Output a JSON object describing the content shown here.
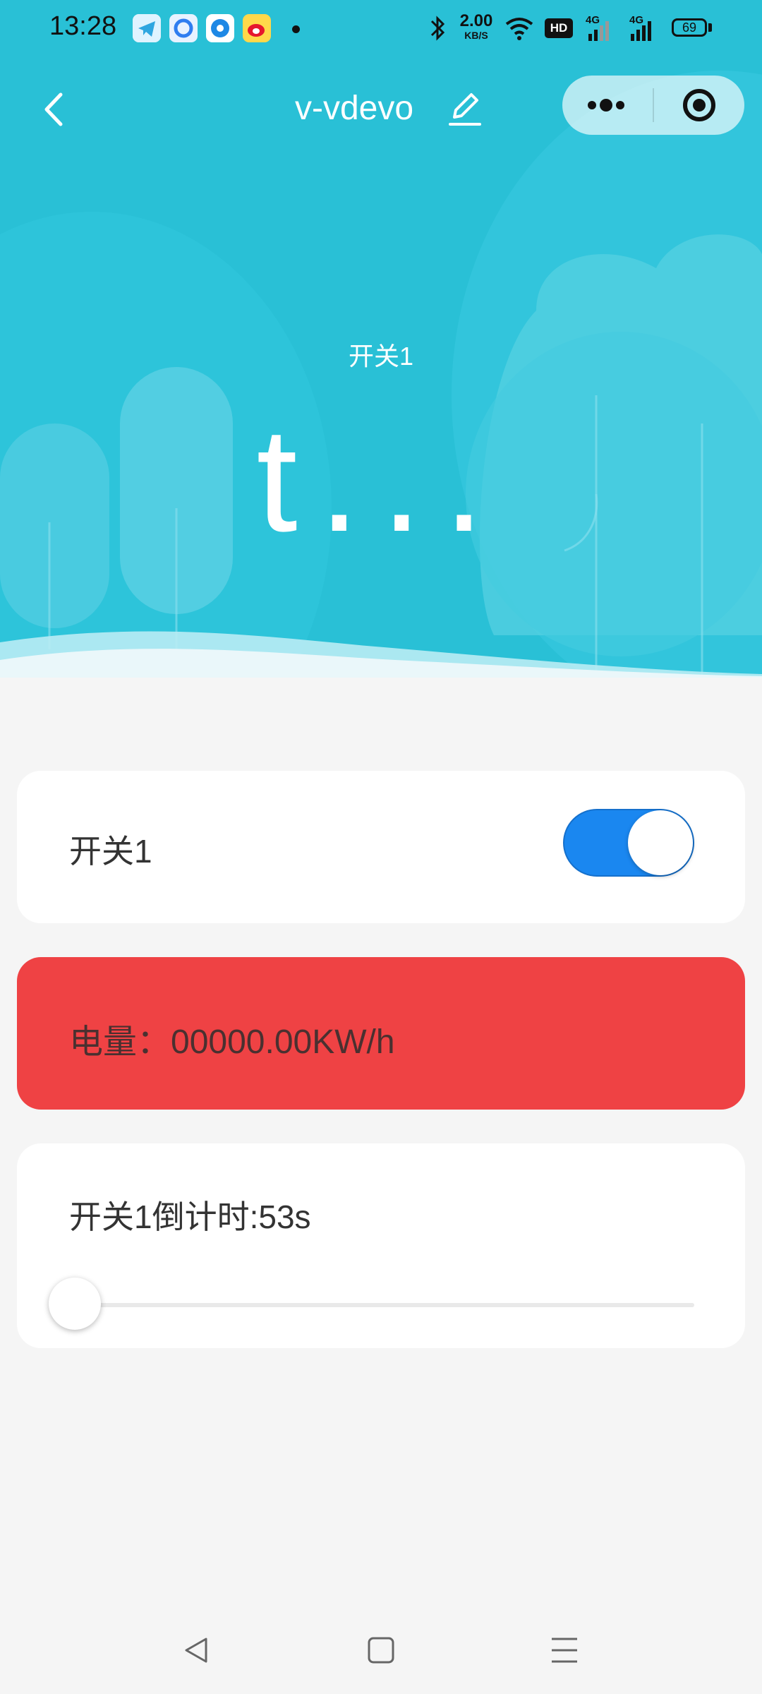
{
  "status_bar": {
    "time": "13:28",
    "net_speed_value": "2.00",
    "net_speed_unit": "KB/S",
    "hd_badge": "HD",
    "net_type_1": "4G",
    "net_type_2": "4G",
    "battery": "69",
    "icons": [
      "telegram-icon",
      "qq-browser-icon",
      "app-icon",
      "weibo-icon",
      "bluetooth-icon",
      "wifi-icon",
      "signal-icon"
    ]
  },
  "nav": {
    "title": "v-vdevo",
    "back_icon": "chevron-left-icon",
    "edit_icon": "pencil-icon",
    "more_icon": "more-dots-icon",
    "close_icon": "target-circle-icon"
  },
  "hero": {
    "label": "开关1",
    "value": "t..."
  },
  "switch_card": {
    "label": "开关1",
    "checked": true
  },
  "energy_card": {
    "text": "电量：00000.00KW/h"
  },
  "timer_card": {
    "label": "开关1倒计时:53s",
    "slider_value": 0
  },
  "colors": {
    "hero_bg": "#29c0d6",
    "toggle_on": "#1a87f0",
    "energy_bg": "#ef4244",
    "page_bg": "#f5f5f5"
  },
  "system_nav": {
    "icons": [
      "back-triangle-icon",
      "home-square-icon",
      "menu-lines-icon"
    ]
  }
}
